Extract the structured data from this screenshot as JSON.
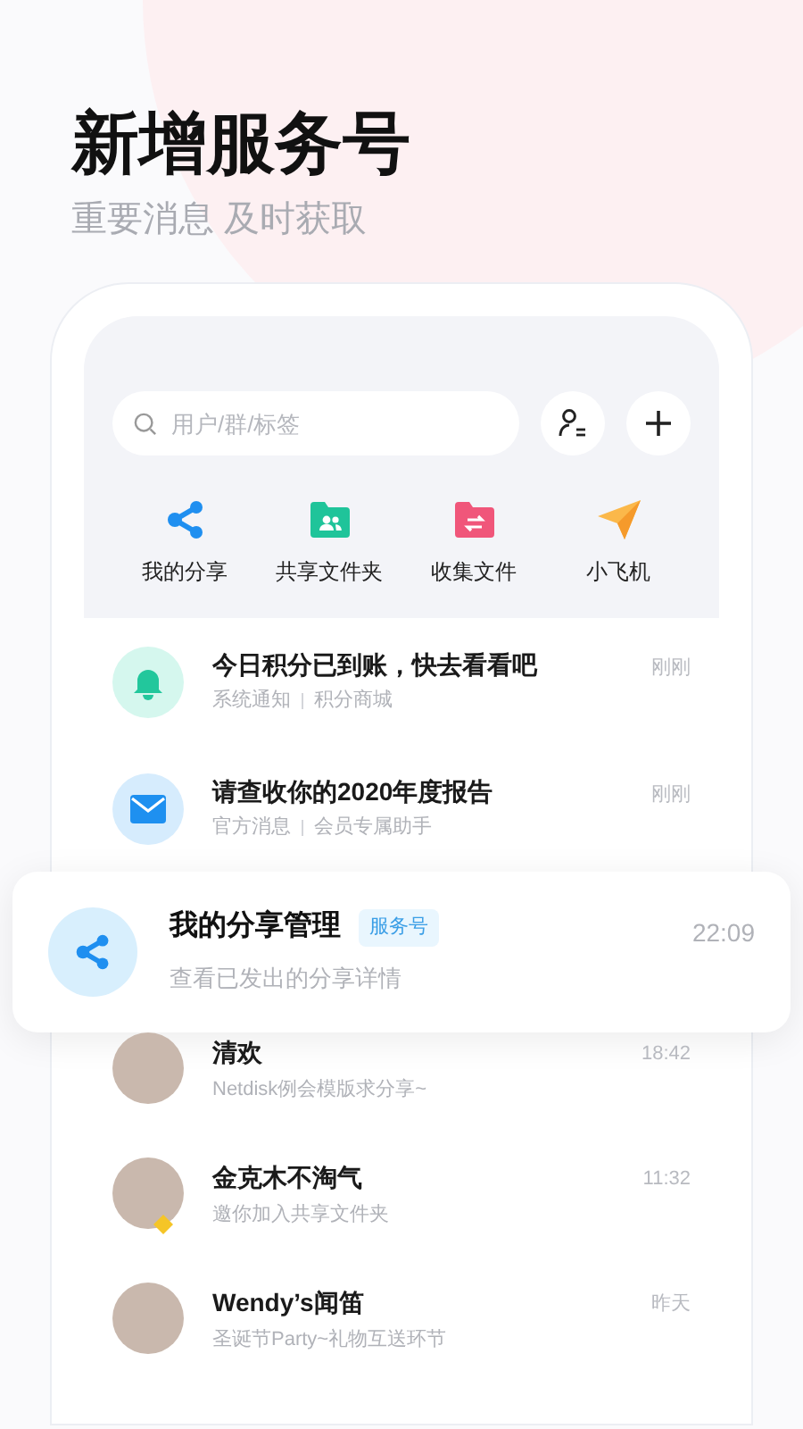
{
  "header": {
    "title": "新增服务号",
    "subtitle": "重要消息 及时获取"
  },
  "search": {
    "placeholder": "用户/群/标签"
  },
  "shortcuts": [
    {
      "kind": "share",
      "label": "我的分享"
    },
    {
      "kind": "folder",
      "label": "共享文件夹"
    },
    {
      "kind": "collect",
      "label": "收集文件"
    },
    {
      "kind": "plane",
      "label": "小飞机"
    }
  ],
  "notices": [
    {
      "kind": "bell",
      "title": "今日积分已到账，快去看看吧",
      "source": "系统通知",
      "sub_source": "积分商城",
      "time": "刚刚"
    },
    {
      "kind": "mail",
      "title": "请查收你的2020年度报告",
      "source": "官方消息",
      "sub_source": "会员专属助手",
      "time": "刚刚"
    }
  ],
  "highlight": {
    "title": "我的分享管理",
    "badge": "服务号",
    "preview": "查看已发出的分享详情",
    "time": "22:09"
  },
  "chats": [
    {
      "name": "清欢",
      "preview": "Netdisk例会模版求分享~",
      "time": "18:42",
      "vip": false
    },
    {
      "name": "金克木不淘气",
      "preview": "邀你加入共享文件夹",
      "time": "11:32",
      "vip": true
    },
    {
      "name": "Wendy’s闻笛",
      "preview": "圣诞节Party~礼物互送环节",
      "time": "昨天",
      "vip": false
    }
  ]
}
